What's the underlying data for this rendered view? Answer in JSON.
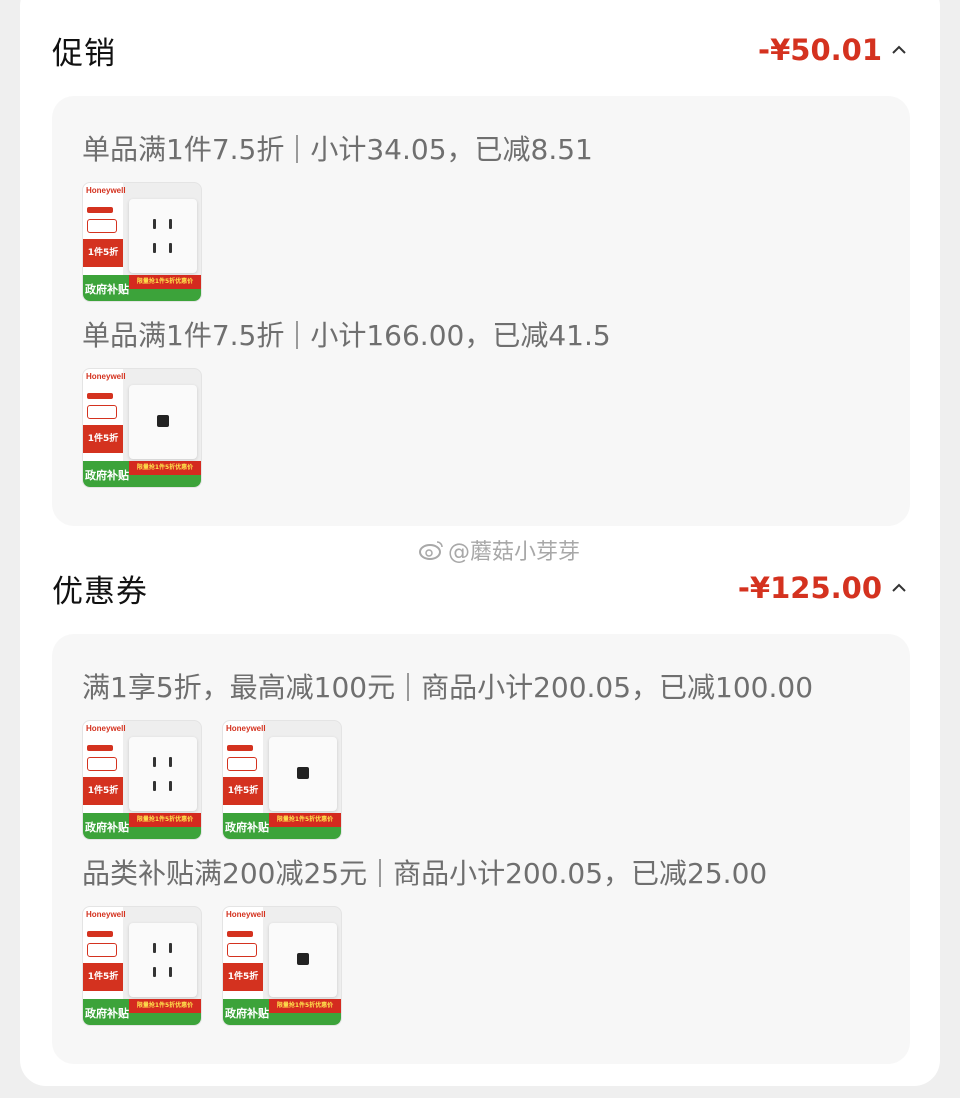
{
  "promo": {
    "title": "促销",
    "amount": "-¥50.01",
    "rules": [
      {
        "text1": "单品满1件7.5折",
        "text2": "小计34.05，已减8.51"
      },
      {
        "text1": "单品满1件7.5折",
        "text2": "小计166.00，已减41.5"
      }
    ]
  },
  "coupon": {
    "title": "优惠券",
    "amount": "-¥125.00",
    "rules": [
      {
        "text1": "满1享5折，最高减100元",
        "text2": "商品小计200.05，已减100.00"
      },
      {
        "text1": "品类补贴满200减25元",
        "text2": "商品小计200.05，已减25.00"
      }
    ]
  },
  "product_thumb": {
    "brand": "Honeywell",
    "badge": "1件5折",
    "banner": "限量抢1件5折优惠价",
    "gov_label": "政府补贴"
  },
  "watermark": "@蘑菇小芽芽",
  "colors": {
    "accent": "#d4321f",
    "panel": "#f7f7f7",
    "muted_text": "#6f6f6f"
  },
  "icons": {
    "collapse": "chevron-up-icon",
    "thumb_outlet": "outlet-socket-icon",
    "thumb_network": "network-socket-icon",
    "watermark": "weibo-icon"
  }
}
